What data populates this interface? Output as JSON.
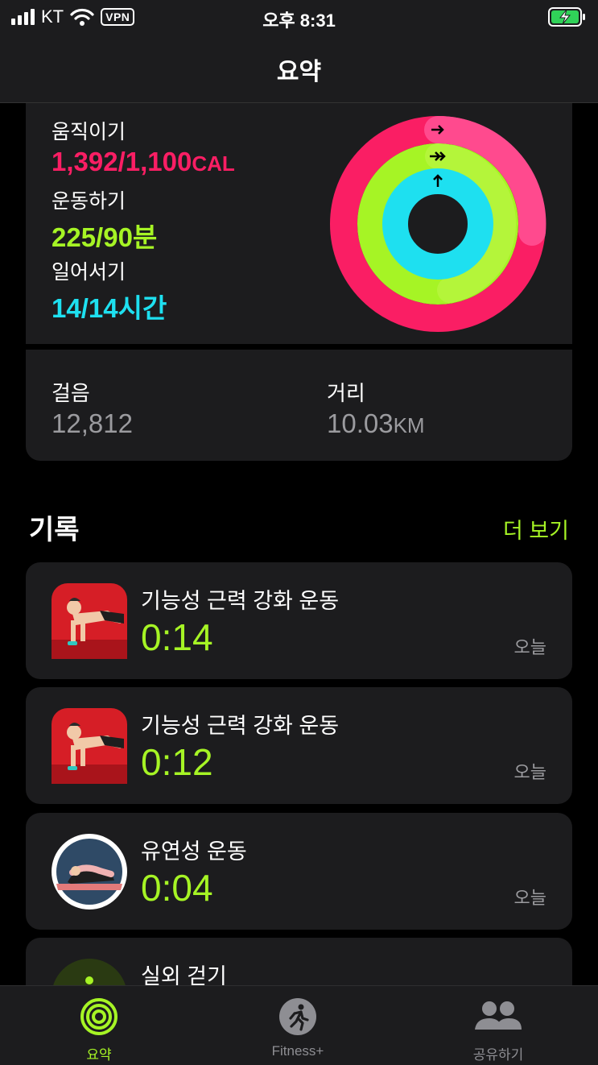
{
  "status_bar": {
    "carrier": "KT",
    "vpn": "VPN",
    "time": "오후 8:31"
  },
  "nav": {
    "title": "요약"
  },
  "activity": {
    "move": {
      "label": "움직이기",
      "value": "1,392/1,100",
      "unit": "CAL",
      "color": "#fa1e64"
    },
    "exercise": {
      "label": "운동하기",
      "value": "225/90분",
      "color": "#a6f425"
    },
    "stand": {
      "label": "일어서기",
      "value": "14/14시간",
      "color": "#1ee0f0"
    }
  },
  "stats": {
    "steps": {
      "label": "걸음",
      "value": "12,812"
    },
    "distance": {
      "label": "거리",
      "value": "10.03",
      "unit": "KM"
    }
  },
  "records": {
    "title": "기록",
    "more": "더 보기",
    "items": [
      {
        "name": "기능성 근력 강화 운동",
        "duration": "0:14",
        "date": "오늘",
        "icon": "pushup-icon"
      },
      {
        "name": "기능성 근력 강화 운동",
        "duration": "0:12",
        "date": "오늘",
        "icon": "pushup-icon"
      },
      {
        "name": "유연성 운동",
        "duration": "0:04",
        "date": "오늘",
        "icon": "stretch-icon"
      },
      {
        "name": "실외 걷기",
        "duration": "",
        "date": "",
        "icon": "walking-icon"
      }
    ]
  },
  "tabs": [
    {
      "label": "요약",
      "icon": "activity-rings-icon",
      "active": true
    },
    {
      "label": "Fitness+",
      "icon": "fitness-runner-icon",
      "active": false
    },
    {
      "label": "공유하기",
      "icon": "people-icon",
      "active": false
    }
  ],
  "colors": {
    "accent": "#a6f425",
    "card": "#1c1c1e",
    "secondary_text": "#9b9b9f"
  }
}
